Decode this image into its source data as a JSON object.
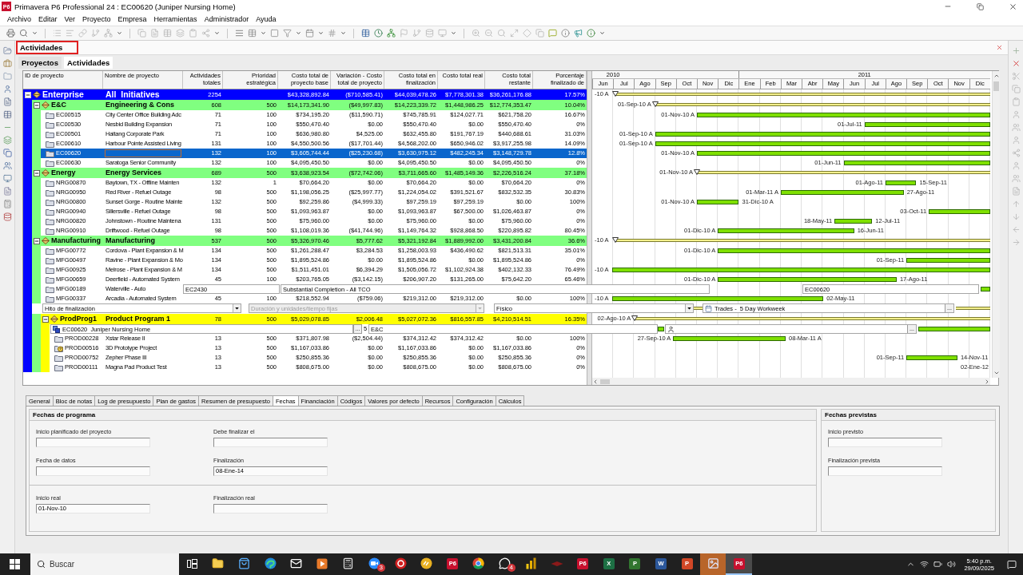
{
  "window": {
    "logo": "P6",
    "title": "Primavera P6 Professional 24 : EC00620 (Juniper Nursing Home)"
  },
  "menu": [
    "Archivo",
    "Editar",
    "Ver",
    "Proyecto",
    "Empresa",
    "Herramientas",
    "Administrador",
    "Ayuda"
  ],
  "workspace": {
    "title": "Actividades",
    "tabs": [
      {
        "label": "Proyectos",
        "selected": false
      },
      {
        "label": "Actividades",
        "selected": true
      }
    ]
  },
  "table": {
    "columns": [
      "ID de proyecto",
      "Nombre de proyecto",
      "Actividades totales",
      "Prioridad estratégica",
      "Costo total de proyecto base",
      "Variación - Costo total de proyecto",
      "Costo total en finalización",
      "Costo total real",
      "Costo total restante",
      "Porcentaje finalizado de"
    ],
    "timeline": {
      "years": [
        {
          "label": "2010",
          "months": [
            "Jun",
            "Jul",
            "Ago",
            "Sep",
            "Oct",
            "Nov",
            "Dic"
          ]
        },
        {
          "label": "2011",
          "months": [
            "Ene",
            "Feb",
            "Mar",
            "Abr",
            "May",
            "Jun",
            "Jul",
            "Ago",
            "Sep",
            "Oct",
            "Nov",
            "Dic"
          ]
        }
      ]
    },
    "rows": [
      {
        "kind": "eps",
        "color": "#0000ff",
        "expanded": true,
        "cells": [
          "Enterprise",
          "All  Initiatives",
          "2254",
          null,
          "$43,328,892.84",
          "($710,585.41)",
          "$44,039,478.26",
          "$7,778,301.38",
          "$36,261,176.88",
          "17.57%"
        ],
        "gantt": {
          "kind": "summary",
          "start_label": "-10 A"
        },
        "children": [
          {
            "kind": "eps",
            "color": "#80ff80",
            "expanded": true,
            "cells": [
              "E&C",
              "Engineering & Cons",
              "608",
              "500",
              "$14,173,341.90",
              "($49,997.83)",
              "$14,223,339.72",
              "$1,448,986.25",
              "$12,774,353.47",
              "10.04%"
            ],
            "gantt": {
              "kind": "summary",
              "start_label": "01-Sep-10 A"
            },
            "children": [
              {
                "kind": "project",
                "selected": false,
                "editing": false,
                "cells": [
                  "EC00515",
                  "City Center Office Building Adc",
                  "71",
                  "100",
                  "$734,195.20",
                  "($11,590.71)",
                  "$745,785.91",
                  "$124,027.71",
                  "$621,758.20",
                  "16.67%"
                ],
                "gantt": {
                  "kind": "bar",
                  "start_label": "01-Nov-10 A"
                }
              },
              {
                "kind": "project",
                "selected": false,
                "editing": false,
                "cells": [
                  "EC00530",
                  "Nesbid Building Expansion",
                  "71",
                  "100",
                  "$550,470.40",
                  "$0.00",
                  "$550,470.40",
                  "$0.00",
                  "$550,470.40",
                  "0%"
                ],
                "gantt": {
                  "kind": "bar",
                  "start_label": "01-Jul-11"
                }
              },
              {
                "kind": "project",
                "selected": false,
                "editing": false,
                "cells": [
                  "EC00501",
                  "Haitang Corporate Park",
                  "71",
                  "100",
                  "$636,980.80",
                  "$4,525.00",
                  "$632,455.80",
                  "$191,767.19",
                  "$440,688.61",
                  "31.03%"
                ],
                "gantt": {
                  "kind": "bar",
                  "start_label": "01-Sep-10 A"
                }
              },
              {
                "kind": "project",
                "selected": false,
                "editing": false,
                "cells": [
                  "EC00610",
                  "Harbour Pointe Assisted Living",
                  "131",
                  "100",
                  "$4,550,500.56",
                  "($17,701.44)",
                  "$4,568,202.00",
                  "$650,946.02",
                  "$3,917,255.98",
                  "14.09%"
                ],
                "gantt": {
                  "kind": "bar",
                  "start_label": "01-Sep-10 A"
                }
              },
              {
                "kind": "project",
                "selected": true,
                "editing": true,
                "cells": [
                  "EC00620",
                  null,
                  "132",
                  "100",
                  "$3,605,744.44",
                  "($25,230.68)",
                  "$3,630,975.12",
                  "$482,245.34",
                  "$3,148,729.78",
                  "12.8%"
                ],
                "gantt": {
                  "kind": "bar",
                  "start_label": "01-Nov-10 A"
                }
              },
              {
                "kind": "project",
                "selected": false,
                "editing": false,
                "cells": [
                  "EC00630",
                  "Saratoga Senior Community",
                  "132",
                  "100",
                  "$4,095,450.50",
                  "$0.00",
                  "$4,095,450.50",
                  "$0.00",
                  "$4,095,450.50",
                  "0%"
                ],
                "gantt": {
                  "kind": "bar",
                  "start_label": "01-Jun-11"
                }
              }
            ]
          },
          {
            "kind": "eps",
            "color": "#80ff80",
            "expanded": true,
            "cells": [
              "Energy",
              "Energy Services",
              "689",
              "500",
              "$3,638,923.54",
              "($72,742.06)",
              "$3,711,665.60",
              "$1,485,149.36",
              "$2,226,516.24",
              "37.18%"
            ],
            "gantt": {
              "kind": "summary",
              "start_label": "01-Nov-10 A"
            },
            "children": [
              {
                "kind": "project",
                "selected": false,
                "editing": false,
                "cells": [
                  "NRG00870",
                  "Baytown, TX - Offline Mainten",
                  "132",
                  "1",
                  "$70,664.20",
                  "$0.00",
                  "$70,664.20",
                  "$0.00",
                  "$70,664.20",
                  "0%"
                ],
                "gantt": {
                  "kind": "bar",
                  "start_label": "01-Ago-11",
                  "end_label": "15-Sep-11"
                }
              },
              {
                "kind": "project",
                "selected": false,
                "editing": false,
                "cells": [
                  "NRG00950",
                  "Red River - Refuel Outage",
                  "98",
                  "500",
                  "$1,198,056.25",
                  "($25,997.77)",
                  "$1,224,054.02",
                  "$391,521.67",
                  "$832,532.35",
                  "30.83%"
                ],
                "gantt": {
                  "kind": "bar",
                  "start_label": "01-Mar-11 A",
                  "end_label": "27-Ago-11"
                }
              },
              {
                "kind": "project",
                "selected": false,
                "editing": false,
                "cells": [
                  "NRG00800",
                  "Sunset Gorge - Routine Mainte",
                  "132",
                  "500",
                  "$92,259.86",
                  "($4,999.33)",
                  "$97,259.19",
                  "$97,259.19",
                  "$0.00",
                  "100%"
                ],
                "gantt": {
                  "kind": "bar",
                  "start_label": "01-Nov-10 A",
                  "end_label": "31-Dic-10 A"
                }
              },
              {
                "kind": "project",
                "selected": false,
                "editing": false,
                "cells": [
                  "NRG00940",
                  "Sillersville - Refuel Outage",
                  "98",
                  "500",
                  "$1,093,963.87",
                  "$0.00",
                  "$1,093,963.87",
                  "$67,500.00",
                  "$1,026,463.87",
                  "0%"
                ],
                "gantt": {
                  "kind": "bar",
                  "start_label": "03-Oct-11"
                }
              },
              {
                "kind": "project",
                "selected": false,
                "editing": false,
                "cells": [
                  "NRG00820",
                  "Johnstown - Routine Maintena",
                  "131",
                  "500",
                  "$75,960.00",
                  "$0.00",
                  "$75,960.00",
                  "$0.00",
                  "$75,960.00",
                  "0%"
                ],
                "gantt": {
                  "kind": "bar",
                  "start_label": "18-May-11",
                  "end_label": "12-Jul-11"
                }
              },
              {
                "kind": "project",
                "selected": false,
                "editing": false,
                "cells": [
                  "NRG00910",
                  "Driftwood - Refuel Outage",
                  "98",
                  "500",
                  "$1,108,019.36",
                  "($41,744.96)",
                  "$1,149,764.32",
                  "$928,868.50",
                  "$220,895.82",
                  "80.45%"
                ],
                "gantt": {
                  "kind": "bar",
                  "start_label": "01-Dic-10 A",
                  "end_label": "16-Jun-11"
                }
              }
            ]
          },
          {
            "kind": "eps",
            "color": "#80ff80",
            "expanded": true,
            "cells": [
              "Manufacturing",
              "Manufacturing",
              "537",
              "500",
              "$5,326,970.46",
              "$5,777.62",
              "$5,321,192.84",
              "$1,889,992.00",
              "$3,431,200.84",
              "36.6%"
            ],
            "gantt": {
              "kind": "summary",
              "start_label": "-10 A"
            },
            "children": [
              {
                "kind": "project",
                "selected": false,
                "editing": false,
                "cells": [
                  "MFG00772",
                  "Cordova - Plant Expansion & M",
                  "134",
                  "500",
                  "$1,261,288.47",
                  "$3,284.53",
                  "$1,258,003.93",
                  "$436,490.62",
                  "$821,513.31",
                  "35.01%"
                ],
                "gantt": {
                  "kind": "bar",
                  "start_label": "01-Dic-10 A"
                }
              },
              {
                "kind": "project",
                "selected": false,
                "editing": false,
                "cells": [
                  "MFG00497",
                  "Ravine - Plant Expansion & Mo",
                  "134",
                  "500",
                  "$1,895,524.86",
                  "$0.00",
                  "$1,895,524.86",
                  "$0.00",
                  "$1,895,524.86",
                  "0%"
                ],
                "gantt": {
                  "kind": "bar",
                  "start_label": "01-Sep-11"
                }
              },
              {
                "kind": "project",
                "selected": false,
                "editing": false,
                "cells": [
                  "MFG00925",
                  "Melrose - Plant Expansion & M",
                  "134",
                  "500",
                  "$1,511,451.01",
                  "$6,394.29",
                  "$1,505,056.72",
                  "$1,102,924.38",
                  "$402,132.33",
                  "76.49%"
                ],
                "gantt": {
                  "kind": "bar",
                  "start_label": "-10 A"
                }
              },
              {
                "kind": "project",
                "selected": false,
                "editing": false,
                "cells": [
                  "MFG00659",
                  "Deerfield - Automated System",
                  "45",
                  "100",
                  "$203,765.05",
                  "($3,142.15)",
                  "$206,907.20",
                  "$131,265.00",
                  "$75,642.20",
                  "65.46%"
                ],
                "gantt": {
                  "kind": "bar",
                  "start_label": "01-Dic-10 A",
                  "end_label": "17-Ago-11"
                }
              },
              {
                "kind": "project",
                "selected": false,
                "editing": false,
                "cells": [
                  "MFG00189",
                  "Waterville - Auto"
                ],
                "overlay": {
                  "code": "EC2430",
                  "description": "Substantial Completion - All TCO",
                  "gantt_code": "EC00620"
                }
              },
              {
                "kind": "project",
                "selected": false,
                "editing": false,
                "cells": [
                  "MFG00337",
                  "Arcadia - Automated System",
                  "45",
                  "100",
                  "$218,552.94",
                  "($759.06)",
                  "$219,312.00",
                  "$219,312.00",
                  "$0.00",
                  "100%"
                ],
                "gantt": {
                  "kind": "bar",
                  "start_label": "-10 A",
                  "end_label": "02-May-11"
                }
              }
            ]
          },
          {
            "kind": "type_strip",
            "color": "#80ff80",
            "fields": [
              {
                "value": "Hito de finalización",
                "disabled": false
              },
              {
                "value": "Duración y unidades/tiempo fijas",
                "disabled": true
              },
              {
                "value": "Físico",
                "disabled": false
              }
            ],
            "calendar": {
              "value": "Trades -  5 Day Workweek",
              "button": "..."
            },
            "children": [
              {
                "kind": "eps",
                "color": "#ffff00",
                "expanded": true,
                "cells": [
                  "ProdProg1",
                  "Product Program 1",
                  "78",
                  "500",
                  "$5,029,078.85",
                  "$2,006.48",
                  "$5,027,072.36",
                  "$816,557.85",
                  "$4,210,514.51",
                  "16.35%"
                ],
                "gantt": {
                  "kind": "summary",
                  "start_label": "02-Ago-10 A"
                },
                "children": [
                  {
                    "kind": "project_strip",
                    "project": {
                      "value": "EC00620  Juniper Nursing Home",
                      "button": "..."
                    },
                    "number": "5",
                    "eps": {
                      "value": "E&C"
                    },
                    "resource": {
                      "button": "..."
                    }
                  },
                  {
                    "kind": "project",
                    "selected": false,
                    "editing": false,
                    "cells": [
                      "PROD00228",
                      "Xstar Release II",
                      "13",
                      "500",
                      "$371,807.98",
                      "($2,504.44)",
                      "$374,312.42",
                      "$374,312.42",
                      "$0.00",
                      "100%"
                    ],
                    "gantt": {
                      "kind": "bar",
                      "start_label": "27-Sep-10 A",
                      "end_label": "08-Mar-11 A"
                    }
                  },
                  {
                    "kind": "whatif",
                    "selected": false,
                    "editing": false,
                    "cells": [
                      "PROD00516",
                      "3D Prototype Project",
                      "13",
                      "500",
                      "$1,167,033.86",
                      "$0.00",
                      "$1,167,033.86",
                      "$0.00",
                      "$1,167,033.86",
                      "0%"
                    ]
                  },
                  {
                    "kind": "project",
                    "selected": false,
                    "editing": false,
                    "cells": [
                      "PROD00752",
                      "Zepher Phase III",
                      "13",
                      "500",
                      "$250,855.36",
                      "$0.00",
                      "$250,855.36",
                      "$0.00",
                      "$250,855.36",
                      "0%"
                    ],
                    "gantt": {
                      "kind": "bar",
                      "start_label": "01-Sep-11",
                      "end_label": "14-Nov-11"
                    }
                  },
                  {
                    "kind": "project",
                    "selected": false,
                    "editing": false,
                    "cells": [
                      "PROD00111",
                      "Magna Pad Product Test",
                      "13",
                      "500",
                      "$808,675.00",
                      "$0.00",
                      "$808,675.00",
                      "$0.00",
                      "$808,675.00",
                      "0%"
                    ],
                    "gantt": {
                      "kind": "bar",
                      "start_label": "02-Ene-12"
                    }
                  }
                ]
              }
            ]
          }
        ]
      }
    ]
  },
  "detail": {
    "tabs": [
      {
        "label": "General",
        "selected": false
      },
      {
        "label": "Bloc de notas",
        "selected": false
      },
      {
        "label": "Log de presupuesto",
        "selected": false
      },
      {
        "label": "Plan de gastos",
        "selected": false
      },
      {
        "label": "Resumen de presupuesto",
        "selected": false
      },
      {
        "label": "Fechas",
        "selected": true
      },
      {
        "label": "Financiación",
        "selected": false
      },
      {
        "label": "Códigos",
        "selected": false
      },
      {
        "label": "Valores por defecto",
        "selected": false
      },
      {
        "label": "Recursos",
        "selected": false
      },
      {
        "label": "Configuración",
        "selected": false
      },
      {
        "label": "Cálculos",
        "selected": false
      }
    ],
    "sections": [
      {
        "title": "Fechas de programa",
        "groups": [
          [
            {
              "label": "Inicio planificado del proyecto"
            },
            {
              "label": "Debe finalizar el"
            },
            {
              "label": "Fecha de datos"
            },
            {
              "label": "Finalización",
              "value": "08-Ene-14"
            }
          ],
          [
            {
              "label": "Inicio real",
              "value": "01-Nov-10"
            },
            {
              "label": "Finalización real"
            }
          ]
        ]
      },
      {
        "title": "Fechas previstas",
        "groups": [
          [
            {
              "label": "Inicio previsto"
            },
            {
              "label": "Finalización prevista"
            }
          ]
        ]
      }
    ]
  },
  "taskbar": {
    "search": {
      "placeholder": "Buscar"
    },
    "apps": [
      {
        "kind": "taskview",
        "selected": false,
        "flashing": false
      },
      {
        "kind": "folder",
        "selected": false,
        "flashing": false
      },
      {
        "kind": "bag",
        "selected": false,
        "flashing": false
      },
      {
        "kind": "swirl",
        "selected": false,
        "flashing": false
      },
      {
        "kind": "envelope",
        "selected": false,
        "flashing": false
      },
      {
        "kind": "play",
        "selected": false,
        "flashing": false
      },
      {
        "kind": "calculator",
        "selected": false,
        "flashing": false
      },
      {
        "kind": "camera",
        "badge": "3",
        "selected": false,
        "flashing": false
      },
      {
        "kind": "ring",
        "selected": false,
        "flashing": false
      },
      {
        "kind": "disc",
        "selected": false,
        "flashing": false
      },
      {
        "kind": "tile",
        "label": "P6",
        "color": "#c8102e",
        "selected": false,
        "flashing": false
      },
      {
        "kind": "wheel",
        "selected": false,
        "flashing": false
      },
      {
        "kind": "chat",
        "badge": "4",
        "selected": false,
        "flashing": false
      },
      {
        "kind": "bars",
        "selected": false,
        "flashing": false
      },
      {
        "kind": "wing",
        "selected": false,
        "flashing": false
      },
      {
        "kind": "tile",
        "label": "P6",
        "color": "#c8102e",
        "selected": false,
        "flashing": false
      },
      {
        "kind": "tile",
        "label": "X",
        "color": "#1d7044",
        "selected": false,
        "flashing": false
      },
      {
        "kind": "tile",
        "label": "P",
        "color": "#31752f",
        "selected": false,
        "flashing": false
      },
      {
        "kind": "tile",
        "label": "W",
        "color": "#2b579a",
        "selected": false,
        "flashing": false
      },
      {
        "kind": "tile",
        "label": "P",
        "color": "#d24726",
        "selected": false,
        "flashing": false
      },
      {
        "kind": "picture",
        "selected": false,
        "flashing": true
      },
      {
        "kind": "tile",
        "label": "P6",
        "color": "#c8102e",
        "selected": true,
        "flashing": false
      }
    ],
    "clock": {
      "time": "5:40 p.m.",
      "date": "29/09/2025"
    }
  }
}
